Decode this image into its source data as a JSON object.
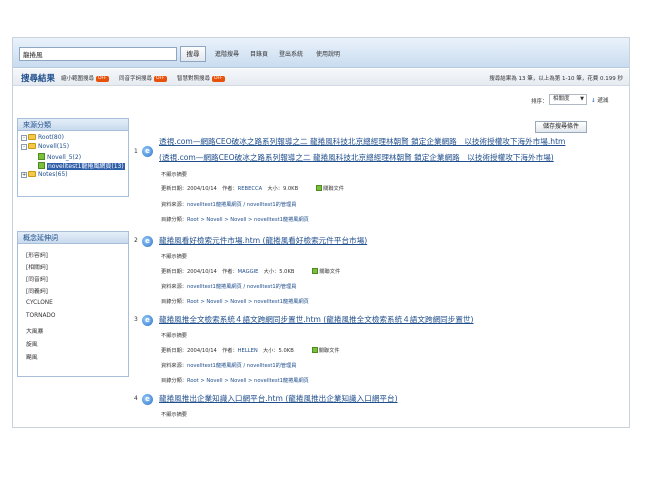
{
  "search": {
    "query": "龍捲風",
    "button": "搜尋"
  },
  "toplinks": [
    "進階搜尋",
    "目錄頁",
    "登出系統",
    "使用說明"
  ],
  "results_header": {
    "title": "搜尋結果",
    "options": [
      {
        "label": "縮小範圍搜尋",
        "state": "OFF"
      },
      {
        "label": "同音字詞搜尋",
        "state": "OFF"
      },
      {
        "label": "智慧對照搜尋",
        "state": "OFF"
      }
    ],
    "stats": "搜尋結果為 13 筆，以上為第 1-10 筆，花費 0.199 秒"
  },
  "sort": {
    "label": "排序：",
    "selected": "相關度",
    "order": "遞減"
  },
  "save_button": "儲存搜尋條件",
  "source_panel": {
    "title": "來源分類",
    "tree": [
      {
        "label": "Root(80)",
        "toggle": "-",
        "level": 0
      },
      {
        "label": "Novell(15)",
        "toggle": "-",
        "level": 1
      },
      {
        "label": "Novell_5(2)",
        "toggle": "",
        "level": 2
      },
      {
        "label": "novelltest1龍捲風網頁(13)",
        "toggle": "",
        "level": 2,
        "selected": true
      },
      {
        "label": "Notes(65)",
        "toggle": "+",
        "level": 1
      }
    ]
  },
  "concept_panel": {
    "title": "概念延伸詞",
    "items": [
      "[形容詞]",
      "[相關詞]",
      "[同音詞]",
      "[同義詞]",
      "CYCLONE",
      "TORNADO",
      "大風暴",
      "旋風",
      "颶風"
    ]
  },
  "results": [
    {
      "num": "1",
      "title_lines": [
        "透視.com—網路CEO破冰之路系列報導之二 龍捲風科技北京總經理林朝賢 鎖定企業網路　以技術授權攻下海外市場.htm",
        "(透視.com—網路CEO破冰之路系列報導之二 龍捲風科技北京總經理林朝賢 鎖定企業網路　以技術授權攻下海外市場)"
      ],
      "summary": "不顯示摘要",
      "date": "2004/10/14",
      "author": "REBECCA",
      "size": "9.0KB",
      "related": "關聯文件",
      "source": "novelltest1龍捲風網頁 / novelltest1的管理員",
      "category": "Root > Novell > Novell > novelltest1龍捲風網頁"
    },
    {
      "num": "2",
      "title_lines": [
        "龍捲風看好檢索元件市場.htm (龍捲風看好檢索元件平台市場)"
      ],
      "summary": "不顯示摘要",
      "date": "2004/10/14",
      "author": "MAGGIE",
      "size": "5.0KB",
      "related": "關聯文件",
      "source": "novelltest1龍捲風網頁 / novelltest1的管理員",
      "category": "Root > Novell > Novell > novelltest1龍捲風網頁"
    },
    {
      "num": "3",
      "title_lines": [
        "龍捲風推全文檢索系統４語文跨網同步置世.htm (龍捲風推全文檢索系統４語文跨網同步置世)"
      ],
      "summary": "不顯示摘要",
      "date": "2004/10/14",
      "author": "HELLEN",
      "size": "5.0KB",
      "related": "關聯文件",
      "source": "novelltest1龍捲風網頁 / novelltest1的管理員",
      "category": "Root > Novell > Novell > novelltest1龍捲風網頁"
    },
    {
      "num": "4",
      "title_lines": [
        "龍捲風推出企業知識入口網平台.htm (龍捲風推出企業知識入口網平台)"
      ],
      "summary": "不顯示摘要"
    }
  ],
  "meta_labels": {
    "date": "更新日期：",
    "author": "作者：",
    "size": "大小：",
    "source": "資料來源：",
    "category": "目錄分類："
  }
}
